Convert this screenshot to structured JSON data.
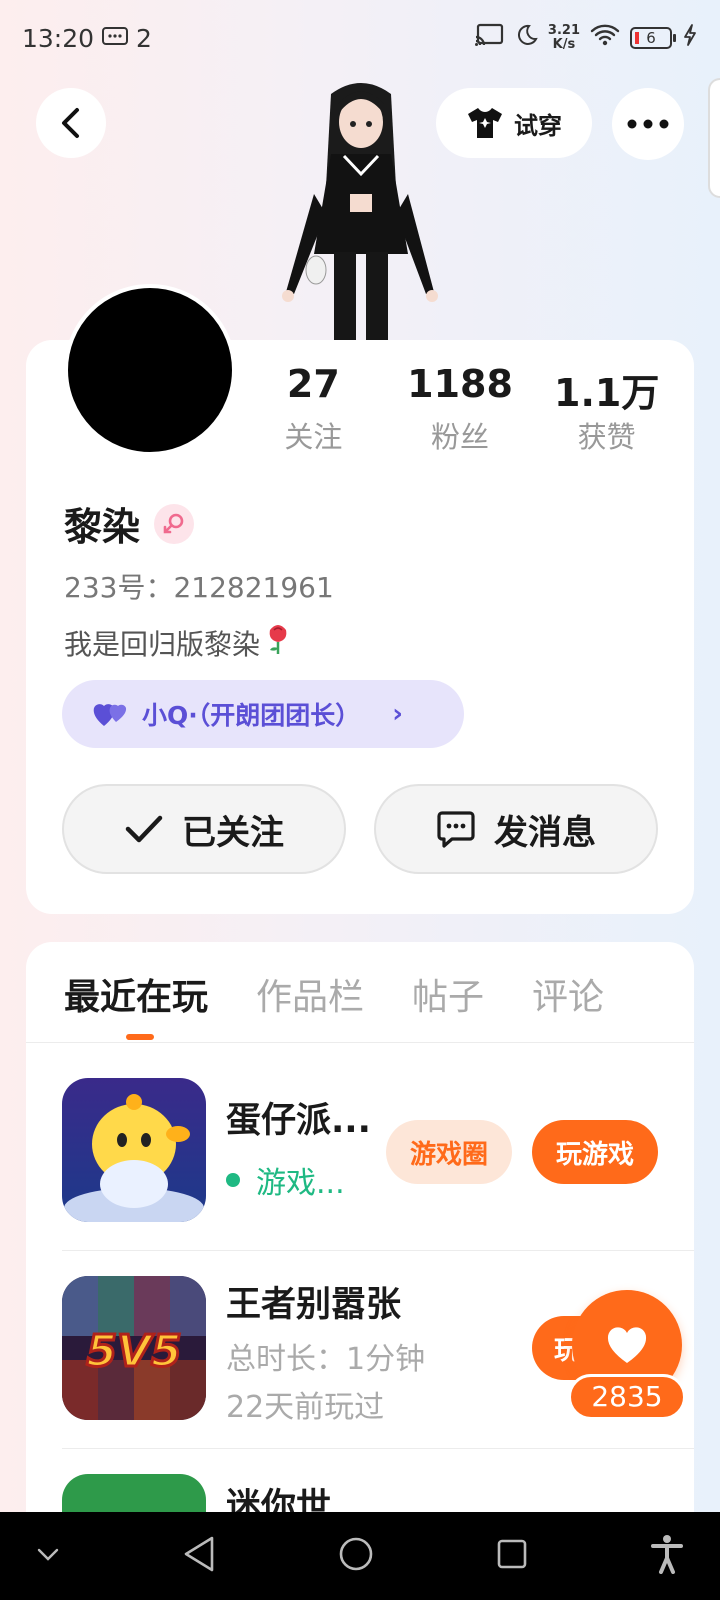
{
  "status_bar": {
    "time": "13:20",
    "notification_count": "2",
    "net_speed_value": "3.21",
    "net_speed_unit": "K/s",
    "battery_level": "6"
  },
  "header": {
    "tryon_label": "试穿"
  },
  "profile": {
    "stats": [
      {
        "value": "27",
        "label": "关注"
      },
      {
        "value": "1188",
        "label": "粉丝"
      },
      {
        "value": "1.1万",
        "label": "获赞"
      }
    ],
    "nickname": "黎染",
    "uid": "233号：212821961",
    "bio": "我是回归版黎染",
    "cp_tag": "小Q·（开朗团团长）",
    "follow_label": "已关注",
    "message_label": "发消息"
  },
  "tabs": [
    "最近在玩",
    "作品栏",
    "帖子",
    "评论"
  ],
  "games": [
    {
      "title": "蛋仔派...",
      "status": "游戏...",
      "circle_label": "游戏圈",
      "play_label": "玩游戏"
    },
    {
      "title": "王者别嚣张",
      "duration": "总时长：1分钟",
      "last_played": "22天前玩过",
      "play_label": "玩"
    },
    {
      "title": "迷你世"
    }
  ],
  "like": {
    "count": "2835"
  },
  "colors": {
    "accent": "#ff6a1a",
    "online": "#1fb983",
    "cp_bg": "#e7e4fb",
    "cp_text": "#5b4fd6"
  }
}
